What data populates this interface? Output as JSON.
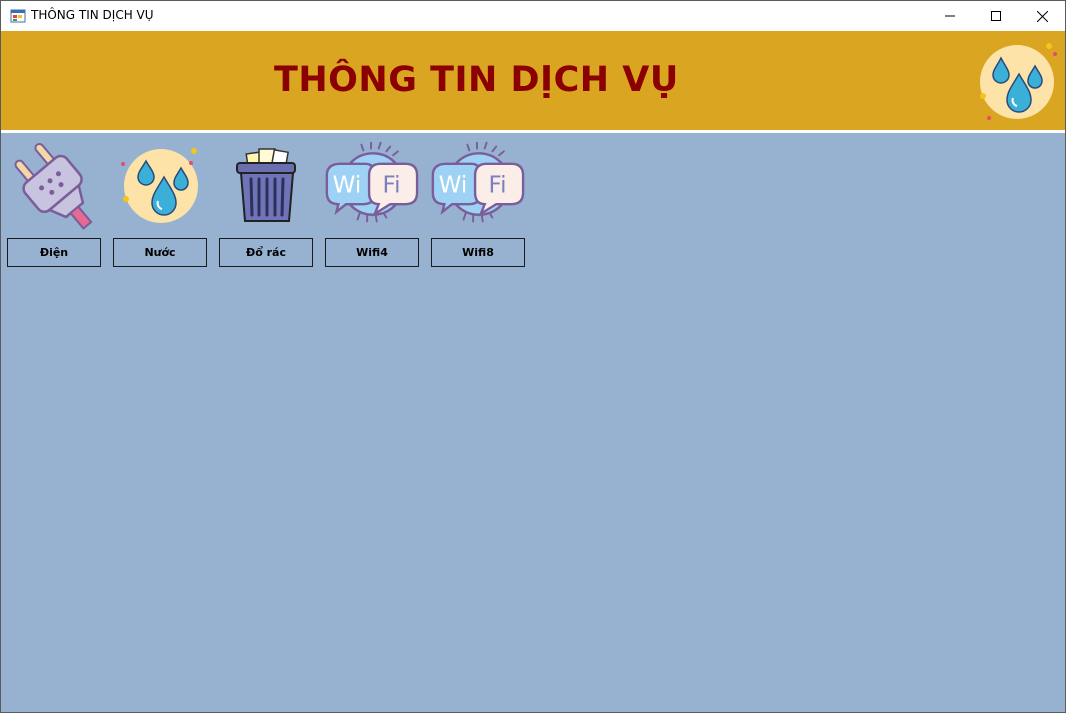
{
  "window": {
    "title": "THÔNG TIN DỊCH VỤ",
    "controls": [
      "minimize",
      "maximize",
      "close"
    ]
  },
  "header": {
    "title": "THÔNG TIN DỊCH VỤ",
    "logo_icon": "water-drops-icon",
    "background": "#daa520",
    "title_color": "#8b0000"
  },
  "services": [
    {
      "label": "Điện",
      "icon": "electric-plug-icon"
    },
    {
      "label": "Nước",
      "icon": "water-drops-icon"
    },
    {
      "label": "Đổ rác",
      "icon": "trash-can-icon"
    },
    {
      "label": "Wifi4",
      "icon": "wifi-bubble-icon"
    },
    {
      "label": "Wifi8",
      "icon": "wifi-bubble-icon"
    }
  ],
  "colors": {
    "window_background": "#97b2d0",
    "titlebar": "#ffffff"
  }
}
